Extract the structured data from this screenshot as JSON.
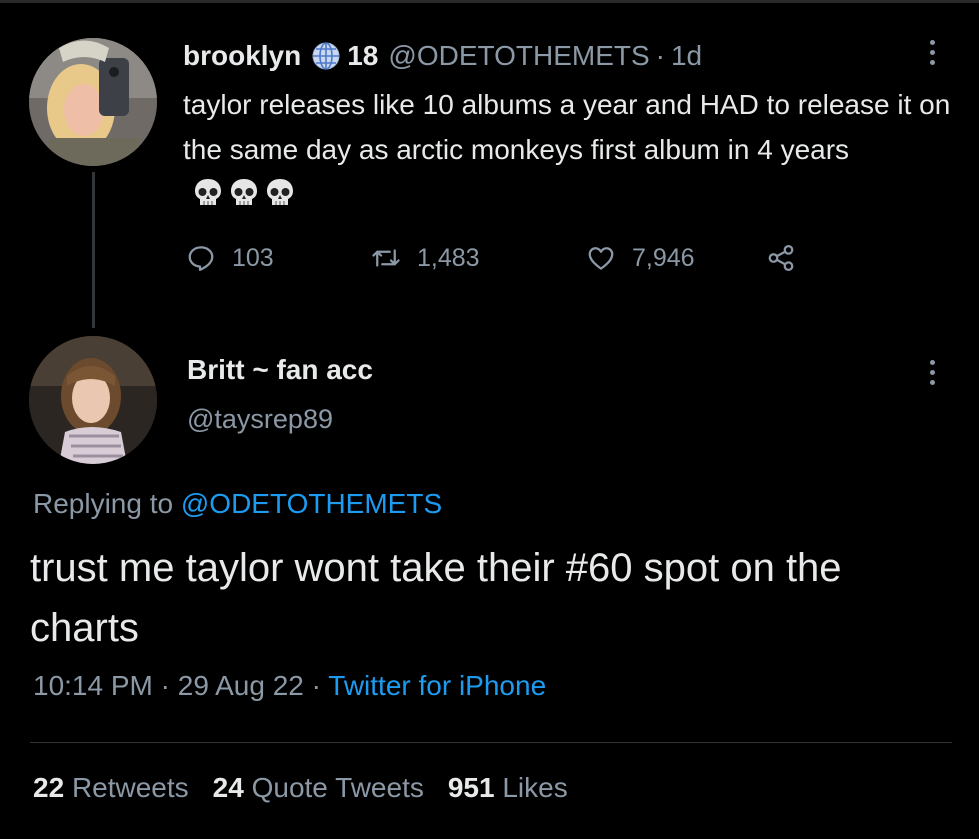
{
  "parent_tweet": {
    "display_name": "brooklyn",
    "name_suffix": "18",
    "handle": "@ODETOTHEMETS",
    "separator": "·",
    "time_ago": "1d",
    "text": "taylor releases like 10 albums a year and HAD to release it on the same day as arctic monkeys first album in 4 years",
    "emoji": [
      "skull",
      "skull",
      "skull"
    ],
    "stats": {
      "replies": "103",
      "retweets": "1,483",
      "likes": "7,946"
    }
  },
  "reply_tweet": {
    "display_name": "Britt ~ fan acc",
    "handle": "@taysrep89",
    "replying_prefix": "Replying to ",
    "replying_to": "@ODETOTHEMETS",
    "text": "trust me taylor wont take their #60 spot on the charts",
    "time": "10:14 PM",
    "separator": "·",
    "date": "29 Aug 22",
    "client": "Twitter for iPhone",
    "stats": {
      "retweets_count": "22",
      "retweets_label": "Retweets",
      "quotes_count": "24",
      "quotes_label": "Quote Tweets",
      "likes_count": "951",
      "likes_label": "Likes"
    }
  },
  "icons": {
    "reply": "speech-bubble",
    "retweet": "retweet-arrows",
    "like": "heart",
    "share": "share-nodes",
    "more": "vertical-ellipsis",
    "badge": "globe"
  },
  "colors": {
    "background": "#000000",
    "text_primary": "#e7e9ea",
    "text_secondary": "#8b98a5",
    "link": "#1d9bf0",
    "divider": "#2f3336"
  }
}
